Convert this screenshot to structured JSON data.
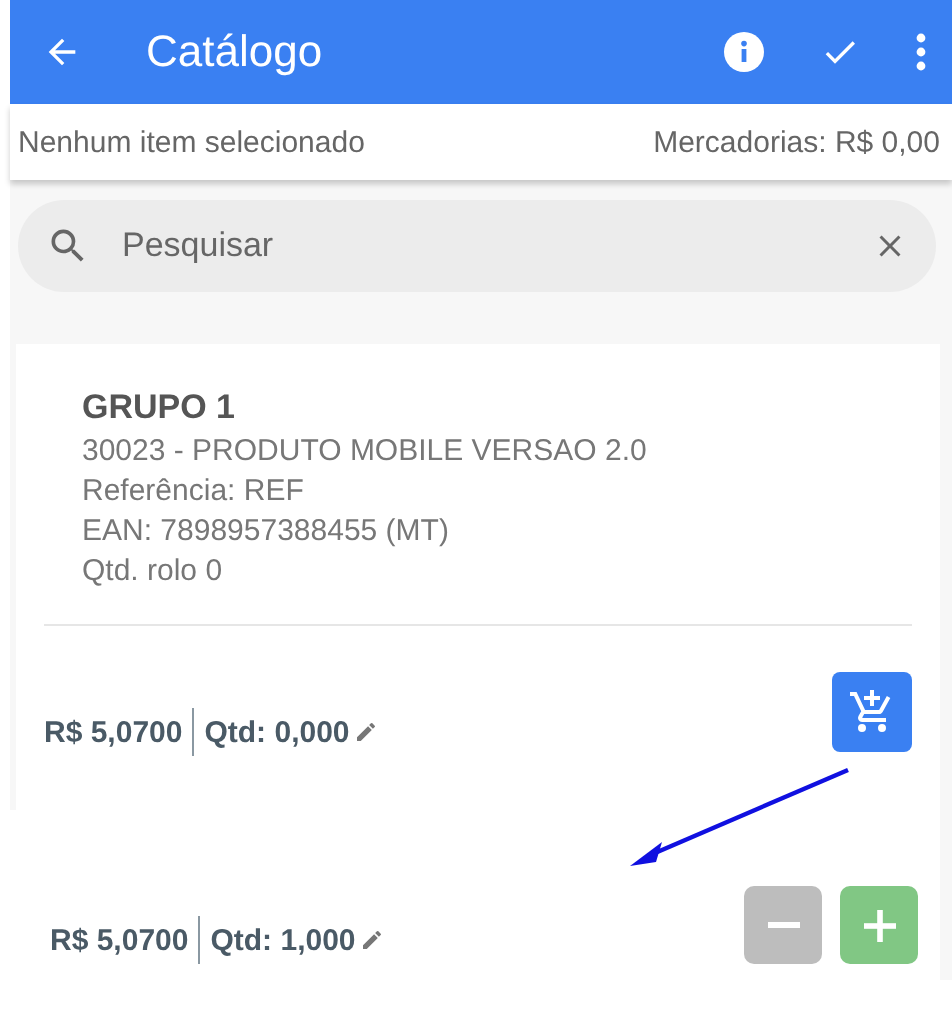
{
  "app_bar": {
    "title": "Catálogo"
  },
  "summary": {
    "selection": "Nenhum item selecionado",
    "total": "Mercadorias: R$ 0,00"
  },
  "search": {
    "placeholder": "Pesquisar"
  },
  "product": {
    "group": "GRUPO 1",
    "details": [
      "30023 - PRODUTO MOBILE VERSAO 2.0",
      "Referência: REF",
      "EAN: 7898957388455 (MT)",
      "Qtd. rolo 0"
    ],
    "price": "R$ 5,0700",
    "quantity": "Qtd: 0,000"
  },
  "after_add": {
    "price": "R$ 5,0700",
    "quantity": "Qtd: 1,000",
    "minus_disabled": true
  }
}
